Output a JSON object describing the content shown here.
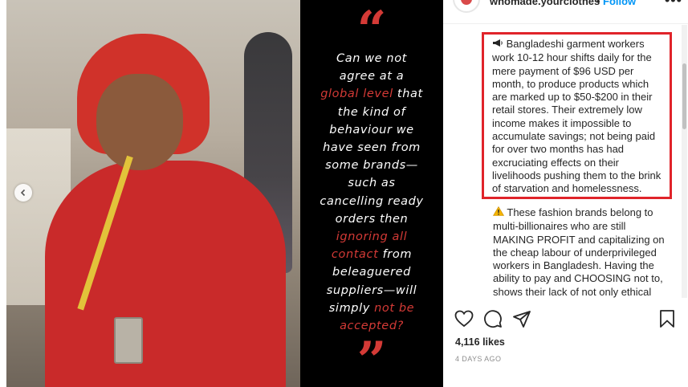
{
  "post": {
    "username": "whomade.yourclothes",
    "dot": "•",
    "follow_label": "Follow",
    "more_label": "•••"
  },
  "image": {
    "quote": {
      "open_mark": "“",
      "close_mark": "”",
      "lines": [
        [
          {
            "t": "Can we not",
            "hl": false
          }
        ],
        [
          {
            "t": "agree at a",
            "hl": false
          }
        ],
        [
          {
            "t": "global level",
            "hl": true
          },
          {
            "t": " that",
            "hl": false
          }
        ],
        [
          {
            "t": "the kind of",
            "hl": false
          }
        ],
        [
          {
            "t": "behaviour we",
            "hl": false
          }
        ],
        [
          {
            "t": "have seen from",
            "hl": false
          }
        ],
        [
          {
            "t": "some brands—",
            "hl": false
          }
        ],
        [
          {
            "t": "such as",
            "hl": false
          }
        ],
        [
          {
            "t": "cancelling ready",
            "hl": false
          }
        ],
        [
          {
            "t": "orders then",
            "hl": false
          }
        ],
        [
          {
            "t": "ignoring all",
            "hl": true
          }
        ],
        [
          {
            "t": "contact",
            "hl": true
          },
          {
            "t": " from",
            "hl": false
          }
        ],
        [
          {
            "t": "beleaguered",
            "hl": false
          }
        ],
        [
          {
            "t": "suppliers—will",
            "hl": false
          }
        ],
        [
          {
            "t": "simply ",
            "hl": false
          },
          {
            "t": "not be",
            "hl": true
          }
        ],
        [
          {
            "t": "accepted?",
            "hl": true
          }
        ]
      ]
    }
  },
  "caption": {
    "block1_icon": "megaphone-icon",
    "block1_lines": [
      "Bangladeshi garment workers",
      "work 10-12 hour shifts daily for the",
      "mere payment of $96 USD per",
      "month, to produce products which",
      "are marked up to $50-$200 in their",
      "retail stores. Their extremely low",
      "income makes it impossible to",
      "accumulate savings; not being paid",
      "for over two months has had",
      "excruciating effects on their",
      "livelihoods pushing them to the brink",
      "of starvation and homelessness."
    ],
    "block2_icon": "warning-icon",
    "block2_lines": [
      "These fashion brands belong to",
      "multi-billionaires who are still",
      "MAKING PROFIT and capitalizing on",
      "the cheap labour of underprivileged",
      "workers in Bangladesh. Having the",
      "ability to pay and CHOOSING not to,",
      "shows their lack of not only ethical"
    ],
    "highlight_color": "#e0242a"
  },
  "stats": {
    "likes": "4,116 likes",
    "time": "4 DAYS AGO"
  },
  "colors": {
    "accent_red": "#d43a36",
    "link_blue": "#0095f6"
  }
}
